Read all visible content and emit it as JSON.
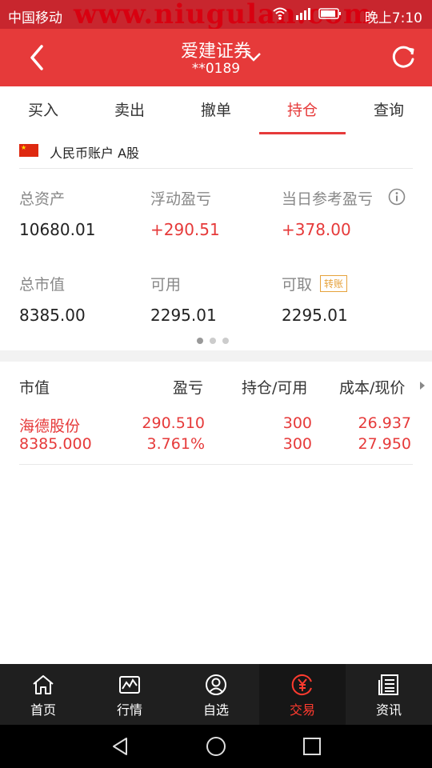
{
  "status_bar": {
    "carrier": "中国移动",
    "watermark": "www.niugulan.com",
    "time": "晚上7:10"
  },
  "header": {
    "title": "爱建证券",
    "account": "**0189"
  },
  "tabs": [
    {
      "label": "买入"
    },
    {
      "label": "卖出"
    },
    {
      "label": "撤单"
    },
    {
      "label": "持仓",
      "active": true
    },
    {
      "label": "查询"
    }
  ],
  "account_line": {
    "label": "人民币账户 A股"
  },
  "summary": {
    "total_assets_label": "总资产",
    "total_assets": "10680.01",
    "float_pl_label": "浮动盈亏",
    "float_pl": "+290.51",
    "daily_pl_label": "当日参考盈亏",
    "daily_pl": "+378.00",
    "market_value_label": "总市值",
    "market_value": "8385.00",
    "available_label": "可用",
    "available": "2295.01",
    "withdrawable_label": "可取",
    "withdrawable": "2295.01",
    "transfer_badge": "转账"
  },
  "table": {
    "headers": [
      "市值",
      "盈亏",
      "持仓/可用",
      "成本/现价"
    ],
    "rows": [
      {
        "name": "海德股份",
        "market_value": "8385.000",
        "pl": "290.510",
        "pl_pct": "3.761%",
        "position": "300",
        "available": "300",
        "cost": "26.937",
        "price": "27.950"
      }
    ]
  },
  "bottom_nav": [
    {
      "label": "首页",
      "icon": "home-icon"
    },
    {
      "label": "行情",
      "icon": "chart-icon"
    },
    {
      "label": "自选",
      "icon": "user-icon"
    },
    {
      "label": "交易",
      "icon": "yen-icon",
      "active": true
    },
    {
      "label": "资讯",
      "icon": "news-icon"
    }
  ],
  "colors": {
    "brand_red": "#e63a3a",
    "gain_red": "#e63a3a",
    "badge_orange": "#e6a23c"
  }
}
